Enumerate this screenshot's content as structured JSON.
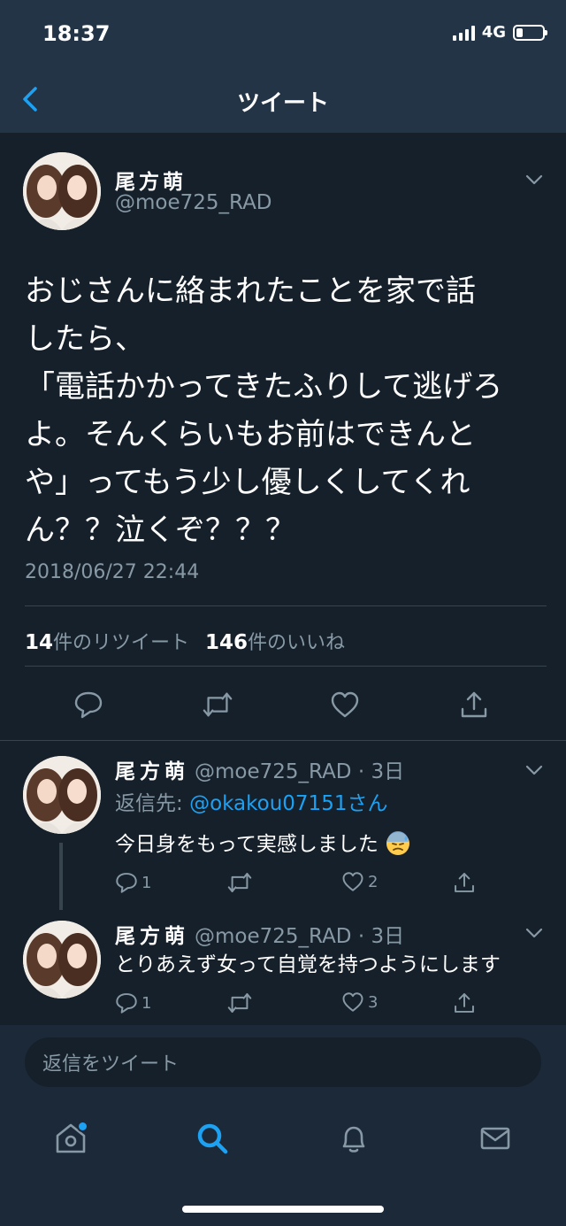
{
  "status_bar": {
    "time": "18:37",
    "network": "4G"
  },
  "nav": {
    "title": "ツイート"
  },
  "main_tweet": {
    "author_name": "尾方萌",
    "handle": "@moe725_RAD",
    "text": "おじさんに絡まれたことを家で話\nしたら、\n「電話かかってきたふりして逃げろ\nよ。そんくらいもお前はできんと\nや」ってもう少し優しくしてくれ\nん？？泣くぞ？？？",
    "timestamp": "2018/06/27 22:44",
    "retweet_count": "14",
    "retweet_label": "件のリツイート",
    "like_count": "146",
    "like_label": "件のいいね"
  },
  "replies": [
    {
      "author_name": "尾方萌",
      "handle_time": "@moe725_RAD · 3日",
      "reply_to_prefix": "返信先: ",
      "reply_to_mention": "@okakou07151",
      "reply_to_suffix": "さん",
      "text": "今日身をもって実感しました",
      "reply_count": "1",
      "like_count": "2"
    },
    {
      "author_name": "尾方萌",
      "handle_time": "@moe725_RAD · 3日",
      "text": "とりあえず女って自覚を持つようにします",
      "reply_count": "1",
      "like_count": "3"
    }
  ],
  "composer": {
    "placeholder": "返信をツイート"
  },
  "colors": {
    "background": "#15202b",
    "header": "#243447",
    "accent": "#1da1f2",
    "muted": "#8899a6"
  }
}
